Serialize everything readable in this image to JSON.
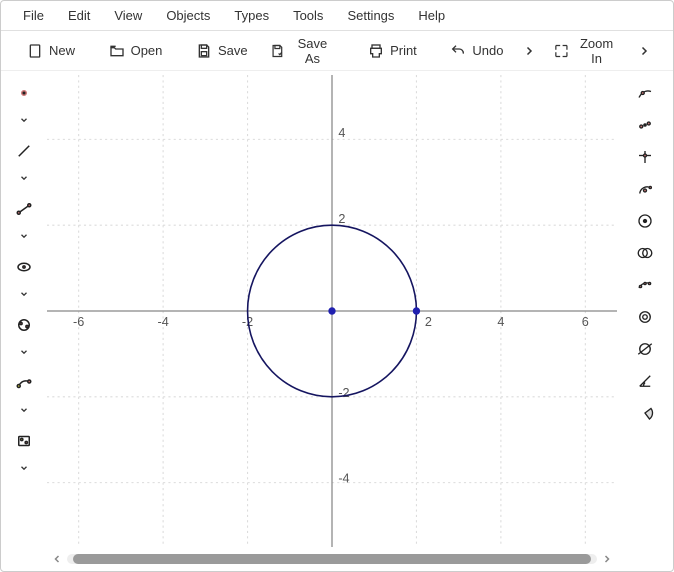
{
  "menubar": [
    "File",
    "Edit",
    "View",
    "Objects",
    "Types",
    "Tools",
    "Settings",
    "Help"
  ],
  "toolbar": {
    "new": "New",
    "open": "Open",
    "save": "Save",
    "saveas": "Save As",
    "print": "Print",
    "undo": "Undo",
    "zoomin": "Zoom In"
  },
  "axes": {
    "x": {
      "labels": [
        "-6",
        "-4",
        "-2",
        "2",
        "4",
        "6"
      ],
      "values": [
        -6,
        -4,
        -2,
        2,
        4,
        6
      ]
    },
    "y": {
      "labels": [
        "4",
        "2",
        "-2",
        "-4"
      ],
      "values": [
        4,
        2,
        -2,
        -4
      ]
    }
  },
  "objects": {
    "circle": {
      "cx": 0,
      "cy": 0,
      "r": 2
    },
    "points": [
      {
        "x": 0,
        "y": 0
      },
      {
        "x": 2,
        "y": 0
      }
    ]
  },
  "left_tools": [
    {
      "name": "point-tool"
    },
    {
      "name": "line-tool"
    },
    {
      "name": "segment-tool"
    },
    {
      "name": "ellipse-tool"
    },
    {
      "name": "conic-tool"
    },
    {
      "name": "transform-tool"
    },
    {
      "name": "text-tool"
    }
  ],
  "right_tools": [
    {
      "name": "point-on-object-icon"
    },
    {
      "name": "midpoint-icon"
    },
    {
      "name": "intersection-icon"
    },
    {
      "name": "arc-center-icon"
    },
    {
      "name": "circle-center-icon"
    },
    {
      "name": "intersect-circles-icon"
    },
    {
      "name": "tangent-arc-icon"
    },
    {
      "name": "circle-radius-icon"
    },
    {
      "name": "ellipse-arc-icon"
    },
    {
      "name": "angle-icon"
    },
    {
      "name": "sector-icon"
    }
  ]
}
